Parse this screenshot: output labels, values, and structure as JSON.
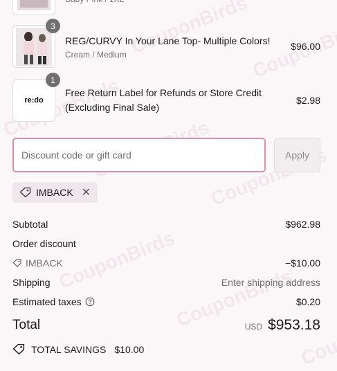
{
  "items": [
    {
      "name": "",
      "variant": "Baby Pink / 1XL",
      "price": ""
    },
    {
      "qty": "3",
      "name": "REG/CURVY In Your Lane Top- Multiple Colors!",
      "variant": "Cream / Medium",
      "price": "$96.00"
    },
    {
      "qty": "1",
      "logo_text": "re:do",
      "name": "Free Return Label for Refunds or Store Credit (Excluding Final Sale)",
      "price": "$2.98"
    }
  ],
  "discount": {
    "placeholder": "Discount code or gift card",
    "apply_label": "Apply",
    "applied_code": "IMBACK"
  },
  "summary": {
    "subtotal_label": "Subtotal",
    "subtotal_value": "$962.98",
    "order_discount_label": "Order discount",
    "discount_code": "IMBACK",
    "discount_value": "−$10.00",
    "shipping_label": "Shipping",
    "shipping_value": "Enter shipping address",
    "taxes_label": "Estimated taxes",
    "taxes_value": "$0.20",
    "total_label": "Total",
    "currency": "USD",
    "total_value": "$953.18",
    "savings_label": "TOTAL SAVINGS",
    "savings_value": "$10.00"
  },
  "watermark": "CouponBirds",
  "colors": {
    "accent": "#d88fb0",
    "background": "#fbf7f9"
  }
}
